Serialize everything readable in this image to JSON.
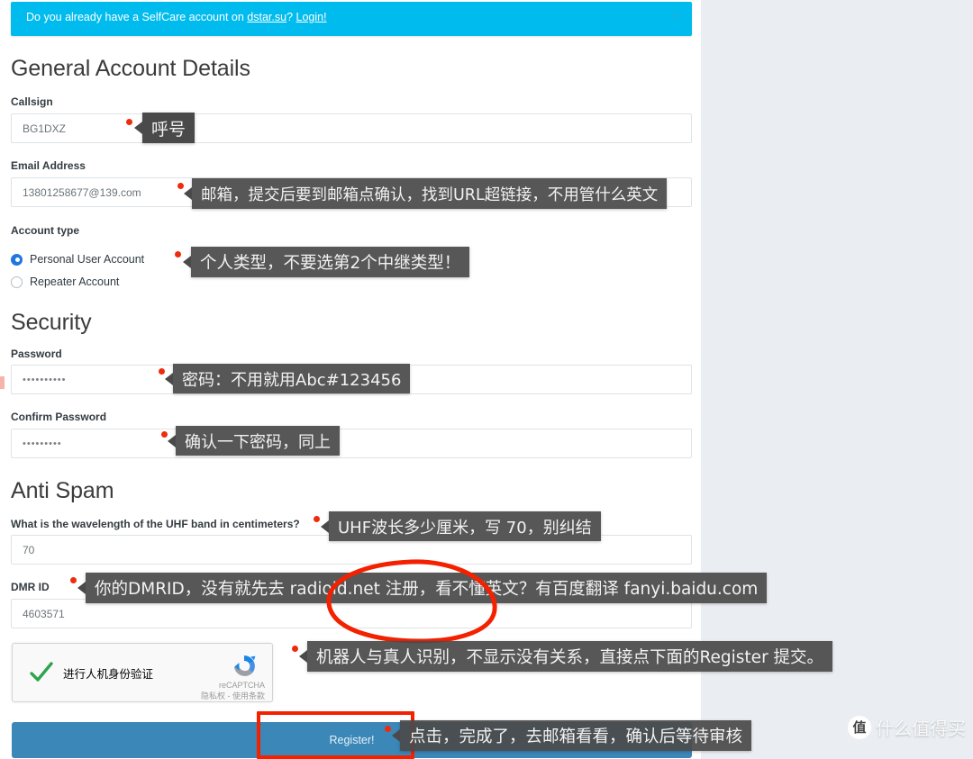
{
  "banner": {
    "text_before": "Do you already have a SelfCare account on ",
    "link_site": "dstar.su",
    "text_mid": "? ",
    "link_login": "Login!",
    "close_label": "×",
    "color": "#00bcee"
  },
  "sections": {
    "general": "General Account Details",
    "security": "Security",
    "antispam": "Anti Spam"
  },
  "fields": {
    "callsign": {
      "label": "Callsign",
      "value": "BG1DXZ"
    },
    "email": {
      "label": "Email Address",
      "value": "13801258677@139.com"
    },
    "account_type": {
      "label": "Account type",
      "options": [
        {
          "label": "Personal User Account",
          "selected": true
        },
        {
          "label": "Repeater Account",
          "selected": false
        }
      ]
    },
    "password": {
      "label": "Password",
      "value": "••••••••••"
    },
    "confirm_password": {
      "label": "Confirm Password",
      "value": "•••••••••"
    },
    "uhf_question": {
      "label": "What is the wavelength of the UHF band in centimeters?",
      "value": "70"
    },
    "dmr_id": {
      "label": "DMR ID",
      "value": "4603571"
    }
  },
  "recaptcha": {
    "checkbox_label": "进行人机身份验证",
    "brand": "reCAPTCHA",
    "terms": "隐私权 - 使用条款"
  },
  "register_button": {
    "label": "Register!",
    "color": "#3a87b8"
  },
  "annotations": {
    "callsign": "呼号",
    "email": "邮箱，提交后要到邮箱点确认，找到URL超链接，不用管什么英文",
    "account_type": "个人类型，不要选第2个中继类型！",
    "password": "密码：不用就用Abc#123456",
    "confirm_password": "确认一下密码，同上",
    "uhf": "UHF波长多少厘米，写 70，别纠结",
    "dmr_id": "你的DMRID，没有就先去 radioid.net 注册，看不懂英文？有百度翻译 fanyi.baidu.com",
    "recaptcha": "机器人与真人识别，不显示没有关系，直接点下面的Register 提交。",
    "register": "点击，完成了，去邮箱看看，确认后等待审核",
    "highlight_color": "#f32100",
    "dot_color": "#ef2b0d"
  },
  "watermark": {
    "mark": "值",
    "text": "什么值得买"
  }
}
